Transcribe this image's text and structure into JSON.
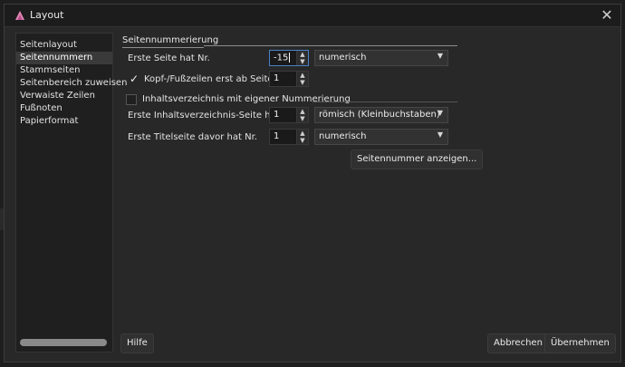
{
  "window": {
    "title": "Layout"
  },
  "sidebar": {
    "items": [
      {
        "label": "Seitenlayout",
        "active": false
      },
      {
        "label": "Seitennummern",
        "active": true
      },
      {
        "label": "Stammseiten",
        "active": false
      },
      {
        "label": "Seitenbereich zuweisen",
        "active": false
      },
      {
        "label": "Verwaiste Zeilen",
        "active": false
      },
      {
        "label": "Fußnoten",
        "active": false
      },
      {
        "label": "Papierformat",
        "active": false
      }
    ]
  },
  "numbering": {
    "heading": "Seitennummerierung",
    "first_page_label": "Erste Seite hat Nr.",
    "first_page_value": "-15",
    "first_page_format": "numerisch",
    "header_footer_label": "Kopf-/Fußzeilen erst ab Seite",
    "header_footer_checked": true,
    "header_footer_value": "1"
  },
  "toc": {
    "heading": "Inhaltsverzeichnis mit eigener Nummerierung",
    "checked": false,
    "first_toc_label": "Erste Inhaltsverzeichnis-Seite hat Nr.",
    "first_toc_value": "1",
    "first_toc_format": "römisch (Kleinbuchstaben)",
    "title_page_label": "Erste Titelseite davor hat Nr.",
    "title_page_value": "1",
    "title_page_format": "numerisch"
  },
  "buttons": {
    "show_number": "Seitennummer anzeigen...",
    "help": "Hilfe",
    "cancel": "Abbrechen",
    "apply": "Übernehmen"
  },
  "colors": {
    "focus": "#4a82c8",
    "background": "#282828",
    "titlebar": "#1c1c1c"
  }
}
